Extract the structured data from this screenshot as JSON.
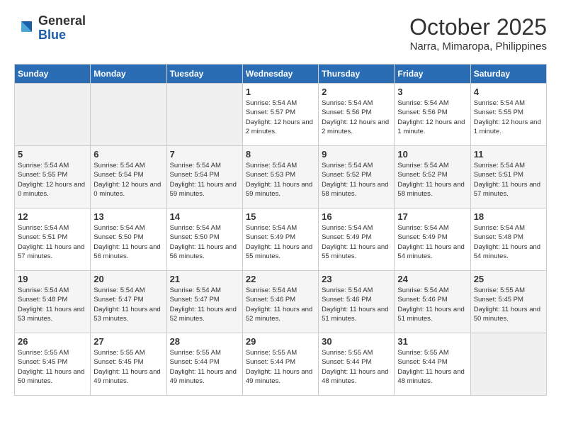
{
  "logo": {
    "general": "General",
    "blue": "Blue"
  },
  "title": "October 2025",
  "location": "Narra, Mimaropa, Philippines",
  "days_of_week": [
    "Sunday",
    "Monday",
    "Tuesday",
    "Wednesday",
    "Thursday",
    "Friday",
    "Saturday"
  ],
  "weeks": [
    [
      {
        "day": "",
        "sunrise": "",
        "sunset": "",
        "daylight": "",
        "empty": true
      },
      {
        "day": "",
        "sunrise": "",
        "sunset": "",
        "daylight": "",
        "empty": true
      },
      {
        "day": "",
        "sunrise": "",
        "sunset": "",
        "daylight": "",
        "empty": true
      },
      {
        "day": "1",
        "sunrise": "Sunrise: 5:54 AM",
        "sunset": "Sunset: 5:57 PM",
        "daylight": "Daylight: 12 hours and 2 minutes."
      },
      {
        "day": "2",
        "sunrise": "Sunrise: 5:54 AM",
        "sunset": "Sunset: 5:56 PM",
        "daylight": "Daylight: 12 hours and 2 minutes."
      },
      {
        "day": "3",
        "sunrise": "Sunrise: 5:54 AM",
        "sunset": "Sunset: 5:56 PM",
        "daylight": "Daylight: 12 hours and 1 minute."
      },
      {
        "day": "4",
        "sunrise": "Sunrise: 5:54 AM",
        "sunset": "Sunset: 5:55 PM",
        "daylight": "Daylight: 12 hours and 1 minute."
      }
    ],
    [
      {
        "day": "5",
        "sunrise": "Sunrise: 5:54 AM",
        "sunset": "Sunset: 5:55 PM",
        "daylight": "Daylight: 12 hours and 0 minutes."
      },
      {
        "day": "6",
        "sunrise": "Sunrise: 5:54 AM",
        "sunset": "Sunset: 5:54 PM",
        "daylight": "Daylight: 12 hours and 0 minutes."
      },
      {
        "day": "7",
        "sunrise": "Sunrise: 5:54 AM",
        "sunset": "Sunset: 5:54 PM",
        "daylight": "Daylight: 11 hours and 59 minutes."
      },
      {
        "day": "8",
        "sunrise": "Sunrise: 5:54 AM",
        "sunset": "Sunset: 5:53 PM",
        "daylight": "Daylight: 11 hours and 59 minutes."
      },
      {
        "day": "9",
        "sunrise": "Sunrise: 5:54 AM",
        "sunset": "Sunset: 5:52 PM",
        "daylight": "Daylight: 11 hours and 58 minutes."
      },
      {
        "day": "10",
        "sunrise": "Sunrise: 5:54 AM",
        "sunset": "Sunset: 5:52 PM",
        "daylight": "Daylight: 11 hours and 58 minutes."
      },
      {
        "day": "11",
        "sunrise": "Sunrise: 5:54 AM",
        "sunset": "Sunset: 5:51 PM",
        "daylight": "Daylight: 11 hours and 57 minutes."
      }
    ],
    [
      {
        "day": "12",
        "sunrise": "Sunrise: 5:54 AM",
        "sunset": "Sunset: 5:51 PM",
        "daylight": "Daylight: 11 hours and 57 minutes."
      },
      {
        "day": "13",
        "sunrise": "Sunrise: 5:54 AM",
        "sunset": "Sunset: 5:50 PM",
        "daylight": "Daylight: 11 hours and 56 minutes."
      },
      {
        "day": "14",
        "sunrise": "Sunrise: 5:54 AM",
        "sunset": "Sunset: 5:50 PM",
        "daylight": "Daylight: 11 hours and 56 minutes."
      },
      {
        "day": "15",
        "sunrise": "Sunrise: 5:54 AM",
        "sunset": "Sunset: 5:49 PM",
        "daylight": "Daylight: 11 hours and 55 minutes."
      },
      {
        "day": "16",
        "sunrise": "Sunrise: 5:54 AM",
        "sunset": "Sunset: 5:49 PM",
        "daylight": "Daylight: 11 hours and 55 minutes."
      },
      {
        "day": "17",
        "sunrise": "Sunrise: 5:54 AM",
        "sunset": "Sunset: 5:49 PM",
        "daylight": "Daylight: 11 hours and 54 minutes."
      },
      {
        "day": "18",
        "sunrise": "Sunrise: 5:54 AM",
        "sunset": "Sunset: 5:48 PM",
        "daylight": "Daylight: 11 hours and 54 minutes."
      }
    ],
    [
      {
        "day": "19",
        "sunrise": "Sunrise: 5:54 AM",
        "sunset": "Sunset: 5:48 PM",
        "daylight": "Daylight: 11 hours and 53 minutes."
      },
      {
        "day": "20",
        "sunrise": "Sunrise: 5:54 AM",
        "sunset": "Sunset: 5:47 PM",
        "daylight": "Daylight: 11 hours and 53 minutes."
      },
      {
        "day": "21",
        "sunrise": "Sunrise: 5:54 AM",
        "sunset": "Sunset: 5:47 PM",
        "daylight": "Daylight: 11 hours and 52 minutes."
      },
      {
        "day": "22",
        "sunrise": "Sunrise: 5:54 AM",
        "sunset": "Sunset: 5:46 PM",
        "daylight": "Daylight: 11 hours and 52 minutes."
      },
      {
        "day": "23",
        "sunrise": "Sunrise: 5:54 AM",
        "sunset": "Sunset: 5:46 PM",
        "daylight": "Daylight: 11 hours and 51 minutes."
      },
      {
        "day": "24",
        "sunrise": "Sunrise: 5:54 AM",
        "sunset": "Sunset: 5:46 PM",
        "daylight": "Daylight: 11 hours and 51 minutes."
      },
      {
        "day": "25",
        "sunrise": "Sunrise: 5:55 AM",
        "sunset": "Sunset: 5:45 PM",
        "daylight": "Daylight: 11 hours and 50 minutes."
      }
    ],
    [
      {
        "day": "26",
        "sunrise": "Sunrise: 5:55 AM",
        "sunset": "Sunset: 5:45 PM",
        "daylight": "Daylight: 11 hours and 50 minutes."
      },
      {
        "day": "27",
        "sunrise": "Sunrise: 5:55 AM",
        "sunset": "Sunset: 5:45 PM",
        "daylight": "Daylight: 11 hours and 49 minutes."
      },
      {
        "day": "28",
        "sunrise": "Sunrise: 5:55 AM",
        "sunset": "Sunset: 5:44 PM",
        "daylight": "Daylight: 11 hours and 49 minutes."
      },
      {
        "day": "29",
        "sunrise": "Sunrise: 5:55 AM",
        "sunset": "Sunset: 5:44 PM",
        "daylight": "Daylight: 11 hours and 49 minutes."
      },
      {
        "day": "30",
        "sunrise": "Sunrise: 5:55 AM",
        "sunset": "Sunset: 5:44 PM",
        "daylight": "Daylight: 11 hours and 48 minutes."
      },
      {
        "day": "31",
        "sunrise": "Sunrise: 5:55 AM",
        "sunset": "Sunset: 5:44 PM",
        "daylight": "Daylight: 11 hours and 48 minutes."
      },
      {
        "day": "",
        "sunrise": "",
        "sunset": "",
        "daylight": "",
        "empty": true
      }
    ]
  ]
}
